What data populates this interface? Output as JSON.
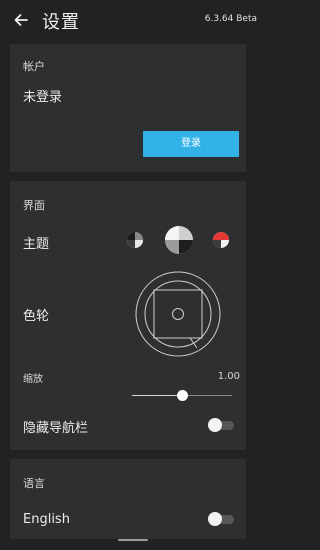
{
  "header": {
    "title": "设置",
    "version": "6.3.64 Beta"
  },
  "account": {
    "section_title": "帐户",
    "status": "未登录",
    "login_label": "登录"
  },
  "interface": {
    "section_title": "界面",
    "theme_label": "主题",
    "color_wheel_label": "色轮",
    "zoom_label": "缩放",
    "zoom_value": "1.00",
    "zoom_position": 0.5,
    "hide_navbar_label": "隐藏导航栏",
    "hide_navbar_on": false
  },
  "language": {
    "section_title": "语言",
    "english_label": "English",
    "english_on": false
  },
  "colors": {
    "background": "#212223",
    "card": "#2e2f31",
    "accent": "#33b2e8",
    "theme_red": "#e53935"
  }
}
